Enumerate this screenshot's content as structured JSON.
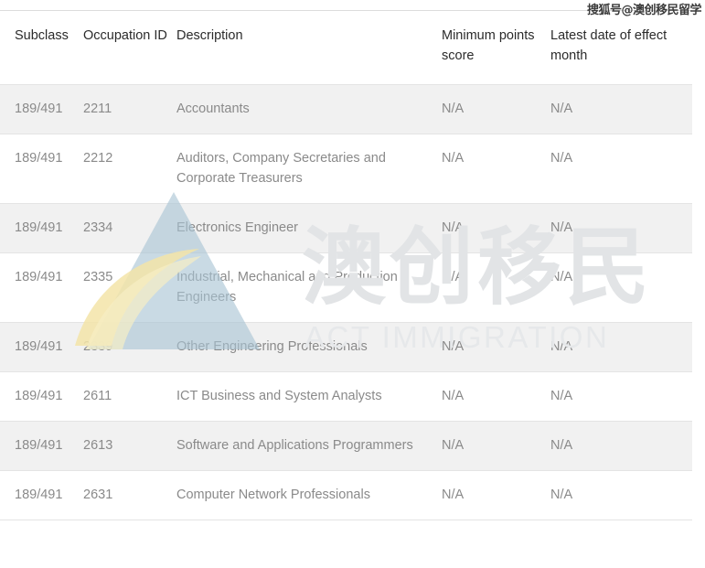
{
  "watermarks": {
    "sohu_tag": "搜狐号@澳创移民留学",
    "brand_cn": "澳创移民",
    "brand_en": "ACT IMMIGRATION",
    "logo_name": "act-immigration-triangle-logo",
    "logo_colors": {
      "triangle": "#a8c4d4",
      "swoosh_yellow": "#f5e7b0",
      "swoosh_blue": "#9cb9cc"
    }
  },
  "table": {
    "columns": [
      {
        "key": "subclass",
        "label": "Subclass"
      },
      {
        "key": "occid",
        "label": "Occupation ID"
      },
      {
        "key": "desc",
        "label": "Description"
      },
      {
        "key": "minpoints",
        "label": "Minimum points score"
      },
      {
        "key": "latest",
        "label": "Latest date of effect month"
      }
    ],
    "rows": [
      {
        "subclass": "189/491",
        "occid": "2211",
        "desc": "Accountants",
        "minpoints": "N/A",
        "latest": "N/A"
      },
      {
        "subclass": "189/491",
        "occid": "2212",
        "desc": "Auditors, Company Secretaries and Corporate Treasurers",
        "minpoints": "N/A",
        "latest": "N/A"
      },
      {
        "subclass": "189/491",
        "occid": "2334",
        "desc": "Electronics Engineer",
        "minpoints": "N/A",
        "latest": "N/A"
      },
      {
        "subclass": "189/491",
        "occid": "2335",
        "desc": "Industrial, Mechanical and Production Engineers",
        "minpoints": "N/A",
        "latest": "N/A"
      },
      {
        "subclass": "189/491",
        "occid": "2339",
        "desc": "Other Engineering Professionals",
        "minpoints": "N/A",
        "latest": "N/A"
      },
      {
        "subclass": "189/491",
        "occid": "2611",
        "desc": "ICT Business and System Analysts",
        "minpoints": "N/A",
        "latest": "N/A"
      },
      {
        "subclass": "189/491",
        "occid": "2613",
        "desc": "Software and Applications Programmers",
        "minpoints": "N/A",
        "latest": "N/A"
      },
      {
        "subclass": "189/491",
        "occid": "2631",
        "desc": "Computer Network Professionals",
        "minpoints": "N/A",
        "latest": "N/A"
      }
    ]
  }
}
